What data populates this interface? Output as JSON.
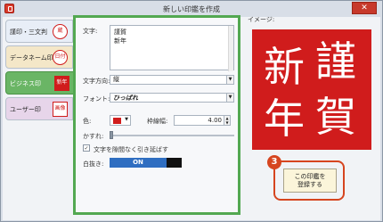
{
  "window": {
    "title": "新しい印鑑を作成",
    "close_glyph": "✕"
  },
  "sidebar": {
    "tabs": [
      {
        "label": "謹印・三文判",
        "stamp": "蔵"
      },
      {
        "label": "データネーム印",
        "stamp": "日付"
      },
      {
        "label": "ビジネス印",
        "stamp": "新年"
      },
      {
        "label": "ユーザー印",
        "stamp": "画像"
      }
    ],
    "selected_index": 2
  },
  "form": {
    "text_label": "文字:",
    "text_lines": [
      "謹賀",
      "新年"
    ],
    "direction_label": "文字方向:",
    "direction_value": "縦",
    "font_label": "フォント:",
    "font_value": "ひっぱれ",
    "color_label": "色:",
    "color_value": "#d01c1c",
    "frame_width_label": "枠線幅:",
    "frame_width_value": "4.00",
    "blur_label": "かすれ:",
    "checkbox_label": "文字を隙間なく引き延ばす",
    "checkbox_checked": true,
    "checkbox_glyph": "✓",
    "white_label": "白抜き:",
    "white_toggle": "ON"
  },
  "preview": {
    "label": "イメージ:",
    "stamp_chars": [
      "謹",
      "賀",
      "新",
      "年"
    ],
    "stamp_color": "#d01c1c"
  },
  "register": {
    "badge": "3",
    "button_line1": "この印鑑を",
    "button_line2": "登録する",
    "accent_color": "#d6451f"
  }
}
